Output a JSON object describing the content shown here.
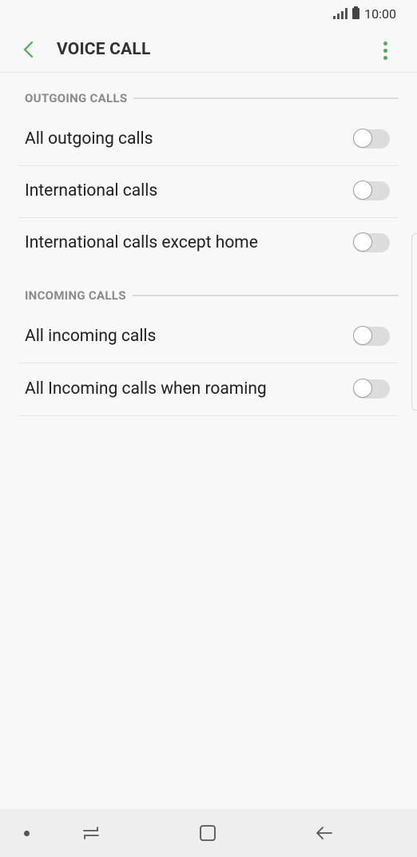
{
  "status_bar": {
    "time": "10:00"
  },
  "app_bar": {
    "title": "VOICE CALL"
  },
  "sections": [
    {
      "header": "OUTGOING CALLS",
      "items": [
        {
          "label": "All outgoing calls",
          "enabled": false
        },
        {
          "label": "International calls",
          "enabled": false
        },
        {
          "label": "International calls except home",
          "enabled": false
        }
      ]
    },
    {
      "header": "INCOMING CALLS",
      "items": [
        {
          "label": "All incoming calls",
          "enabled": false
        },
        {
          "label": "All Incoming calls when roaming",
          "enabled": false
        }
      ]
    }
  ],
  "colors": {
    "accent": "#4caf50",
    "text": "#222222",
    "section_header": "#8a8a8a"
  },
  "icons": {
    "back": "chevron-left-icon",
    "menu": "more-vertical-icon",
    "recents": "recents-icon",
    "home": "home-icon",
    "nav_back": "back-arrow-icon"
  }
}
